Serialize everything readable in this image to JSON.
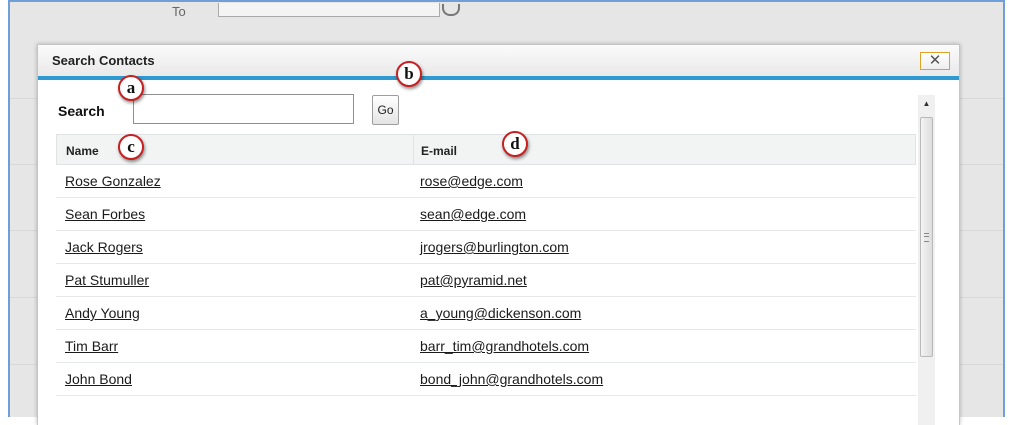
{
  "background": {
    "to_label": "To"
  },
  "dialog": {
    "title": "Search Contacts",
    "close_label": "✕",
    "search": {
      "label": "Search",
      "value": "",
      "placeholder": ""
    },
    "go_label": "Go",
    "table": {
      "headers": {
        "name": "Name",
        "email": "E-mail"
      },
      "rows": [
        {
          "name": "Rose Gonzalez",
          "email": "rose@edge.com"
        },
        {
          "name": "Sean Forbes",
          "email": "sean@edge.com"
        },
        {
          "name": "Jack Rogers",
          "email": "jrogers@burlington.com"
        },
        {
          "name": "Pat Stumuller",
          "email": "pat@pyramid.net"
        },
        {
          "name": "Andy Young",
          "email": "a_young@dickenson.com"
        },
        {
          "name": "Tim Barr",
          "email": "barr_tim@grandhotels.com"
        },
        {
          "name": "John Bond",
          "email": "bond_john@grandhotels.com"
        }
      ]
    }
  },
  "callouts": {
    "a": "a",
    "b": "b",
    "c": "c",
    "d": "d"
  },
  "colors": {
    "accent": "#2f9ad1",
    "callout_border": "#c62020",
    "close_border": "#e0a32a",
    "window_border": "#6f9fd6"
  }
}
